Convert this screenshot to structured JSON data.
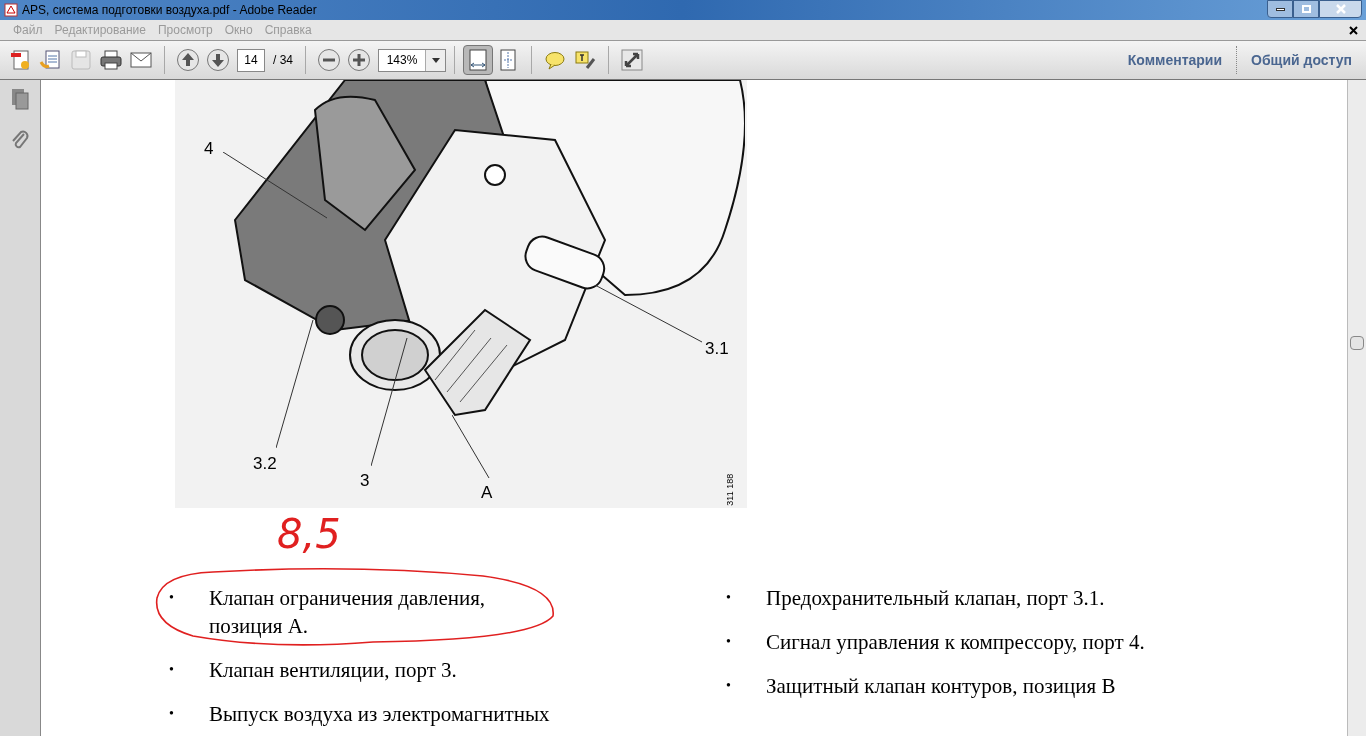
{
  "window": {
    "title": "APS, система подготовки воздуха.pdf - Adobe Reader"
  },
  "menu": [
    "Файл",
    "Редактирование",
    "Просмотр",
    "Окно",
    "Справка"
  ],
  "toolbar": {
    "page_number": "14",
    "page_total": "/ 34",
    "zoom": "143%",
    "view_buttons": [
      {
        "selected": true
      },
      {
        "selected": false
      }
    ],
    "panes": [
      "Комментарии",
      "Общий доступ"
    ]
  },
  "document": {
    "figure": {
      "callouts": [
        {
          "label": "4"
        },
        {
          "label": "3.1"
        },
        {
          "label": "3.2"
        },
        {
          "label": "3"
        },
        {
          "label": "A"
        }
      ],
      "figure_number": "311 188"
    },
    "handwritten_note": "8,5",
    "columns": [
      [
        {
          "bullet": "•",
          "text": "Клапан ограничения давления, позиция A.",
          "circled": true
        },
        {
          "bullet": "•",
          "text": "Клапан вентиляции, порт 3.",
          "circled": false
        },
        {
          "bullet": "•",
          "text": "Выпуск воздуха из электромагнитных",
          "circled": false
        }
      ],
      [
        {
          "bullet": "•",
          "text": "Предохранительный клапан, порт 3.1.",
          "circled": false
        },
        {
          "bullet": "•",
          "text": "Сигнал управления к компрессору, порт 4.",
          "circled": false
        },
        {
          "bullet": "•",
          "text": "Защитный клапан контуров, позиция B",
          "circled": false
        }
      ]
    ]
  }
}
